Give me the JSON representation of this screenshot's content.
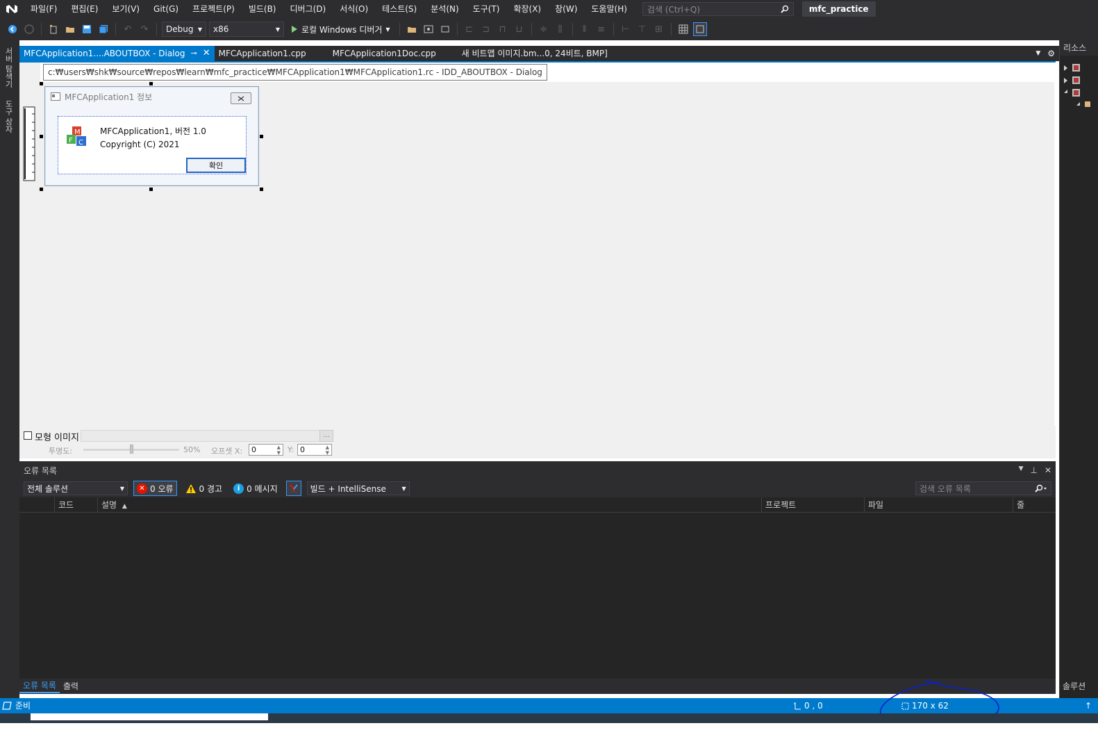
{
  "menubar": {
    "items": [
      "파일(F)",
      "편집(E)",
      "보기(V)",
      "Git(G)",
      "프로젝트(P)",
      "빌드(B)",
      "디버그(D)",
      "서식(O)",
      "테스트(S)",
      "분석(N)",
      "도구(T)",
      "확장(X)",
      "창(W)",
      "도움말(H)"
    ],
    "search_placeholder": "검색 (Ctrl+Q)",
    "solution_name": "mfc_practice"
  },
  "toolbar": {
    "configuration": "Debug",
    "platform": "x86",
    "run_label": "로컬 Windows 디버거"
  },
  "left_strip": {
    "tab1": "서버 탐색기",
    "tab2": "도구 상자"
  },
  "right_strip": {
    "header": "리소스",
    "bottom_label": "솔루션"
  },
  "doc_tabs": [
    {
      "label": "MFCApplication1....ABOUTBOX - Dialog",
      "active": true
    },
    {
      "label": "MFCApplication1.cpp",
      "active": false
    },
    {
      "label": "MFCApplication1Doc.cpp",
      "active": false
    },
    {
      "label": "새 비트맵 이미지.bm...0, 24비트, BMP]",
      "active": false
    }
  ],
  "editor": {
    "path_tooltip": "c:₩users₩shk₩source₩repos₩learn₩mfc_practice₩MFCApplication1₩MFCApplication1.rc - IDD_ABOUTBOX - Dialog",
    "dialog": {
      "title": "MFCApplication1 정보",
      "line1": "MFCApplication1, 버전 1.0",
      "line2": "Copyright (C) 2021",
      "ok_label": "확인"
    },
    "model_bar": {
      "model_image_label": "모형 이미지",
      "browse_label": "...",
      "opacity_label": "투명도:",
      "opacity_value": "50%",
      "opacity_fraction": 0.5,
      "offset_label": "오프셋 X:",
      "offset_x": "0",
      "offset_y_label": "Y:",
      "offset_y": "0"
    }
  },
  "error_list": {
    "title": "오류 목록",
    "scope": "전체 솔루션",
    "errors": "0 오류",
    "warnings": "0 경고",
    "messages": "0 메시지",
    "build_filter": "빌드 + IntelliSense",
    "search_placeholder": "검색 오류 목록",
    "columns": [
      "코드",
      "설명",
      "프로젝트",
      "파일",
      "줄"
    ]
  },
  "bottom_tabs": [
    "오류 목록",
    "출력"
  ],
  "statusbar": {
    "ready": "준비",
    "position": "0 , 0",
    "size": "170 x 62"
  },
  "colors": {
    "accent": "#007acc",
    "annotation": "#0b1fd1",
    "error": "#e51400",
    "warning": "#ffcc00",
    "info": "#1ba1e2"
  }
}
